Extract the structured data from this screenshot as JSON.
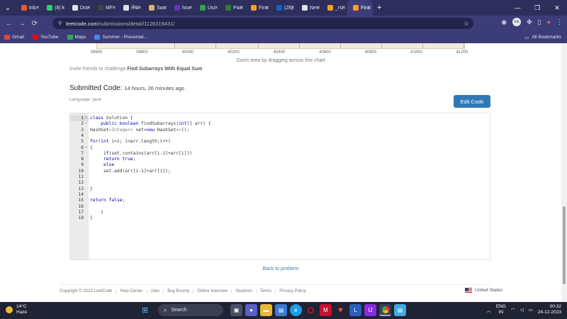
{
  "browser": {
    "tabs": [
      {
        "label": "trib",
        "color": "#e85a2c"
      },
      {
        "label": "(8) \\",
        "color": "#25d366"
      },
      {
        "label": "Dov",
        "color": "#e0e0e0"
      },
      {
        "label": "MF",
        "color": "#444444"
      },
      {
        "label": "लेख",
        "color": "#e0e0e0"
      },
      {
        "label": "San",
        "color": "#d9b56a"
      },
      {
        "label": "hov",
        "color": "#6a2fbf"
      },
      {
        "label": "Usi",
        "color": "#2fa54a"
      },
      {
        "label": "Pair",
        "color": "#2e7d32"
      },
      {
        "label": "Finc",
        "color": "#f89f1b"
      },
      {
        "label": "(28)",
        "color": "#0a66c2"
      },
      {
        "label": "Nev",
        "color": "#e0e0e0"
      },
      {
        "label": "_rsi",
        "color": "#f89f1b"
      },
      {
        "label": "Finc",
        "color": "#f89f1b",
        "active": true
      }
    ],
    "new_tab": "+",
    "url_host": "leetcode.com",
    "url_path": "/submissions/detail/1126319431/",
    "profile_initials": "Ink",
    "bookmarks": [
      {
        "label": "Gmail",
        "color": "#ea4335"
      },
      {
        "label": "YouTube",
        "color": "#ff0000"
      },
      {
        "label": "Maps",
        "color": "#34a853"
      },
      {
        "label": "Summer - Presentat...",
        "color": "#4285f4"
      }
    ],
    "all_bookmarks": "All Bookmarks"
  },
  "chart": {
    "ticks": [
      "39600",
      "39800",
      "40000",
      "40200",
      "40400",
      "40600",
      "40800",
      "41000",
      "41200"
    ],
    "zoom_note": "Zoom area by dragging across this chart"
  },
  "invite": {
    "prefix": "Invite friends to challenge ",
    "problem": "Find Subarrays With Equal Sum"
  },
  "submission": {
    "title": "Submitted Code:",
    "time": "14 hours, 26 minutes ago",
    "language_label": "Language: java",
    "edit_button": "Edit Code"
  },
  "code": {
    "lines": [
      {
        "n": "1",
        "fold": true,
        "text": "class Solution {"
      },
      {
        "n": "2",
        "fold": true,
        "text": "    public boolean findSubarrays(int[] arr) {"
      },
      {
        "n": "3",
        "text": "HashSet<Integer> set=new HashSet<>();"
      },
      {
        "n": "4",
        "text": ""
      },
      {
        "n": "5",
        "text": "for(int i=1; i<arr.length;i++)"
      },
      {
        "n": "6",
        "fold": true,
        "text": "{"
      },
      {
        "n": "7",
        "text": "     if(set.contains(arr[i-1]+arr[i]))"
      },
      {
        "n": "8",
        "text": "     return true;"
      },
      {
        "n": "9",
        "text": "     else"
      },
      {
        "n": "10",
        "text": "     set.add(arr[i-1]+arr[i]);"
      },
      {
        "n": "11",
        "text": ""
      },
      {
        "n": "12",
        "text": ""
      },
      {
        "n": "13",
        "text": "}"
      },
      {
        "n": "14",
        "text": ""
      },
      {
        "n": "15",
        "text": "return false;"
      },
      {
        "n": "16",
        "text": ""
      },
      {
        "n": "17",
        "text": "    }"
      },
      {
        "n": "18",
        "text": "}"
      }
    ]
  },
  "back_link": "Back to problem",
  "footer": {
    "links": [
      "Copyright © 2023 LeetCode",
      "Help Center",
      "Jobs",
      "Bug Bounty",
      "Online Interview",
      "Students",
      "Terms",
      "Privacy Policy"
    ],
    "region": "United States"
  },
  "taskbar": {
    "temp": "14°C",
    "condition": "Haze",
    "search": "Search",
    "lang_line1": "ENG",
    "lang_line2": "IN",
    "time": "00:32",
    "date": "24-12-2023"
  }
}
